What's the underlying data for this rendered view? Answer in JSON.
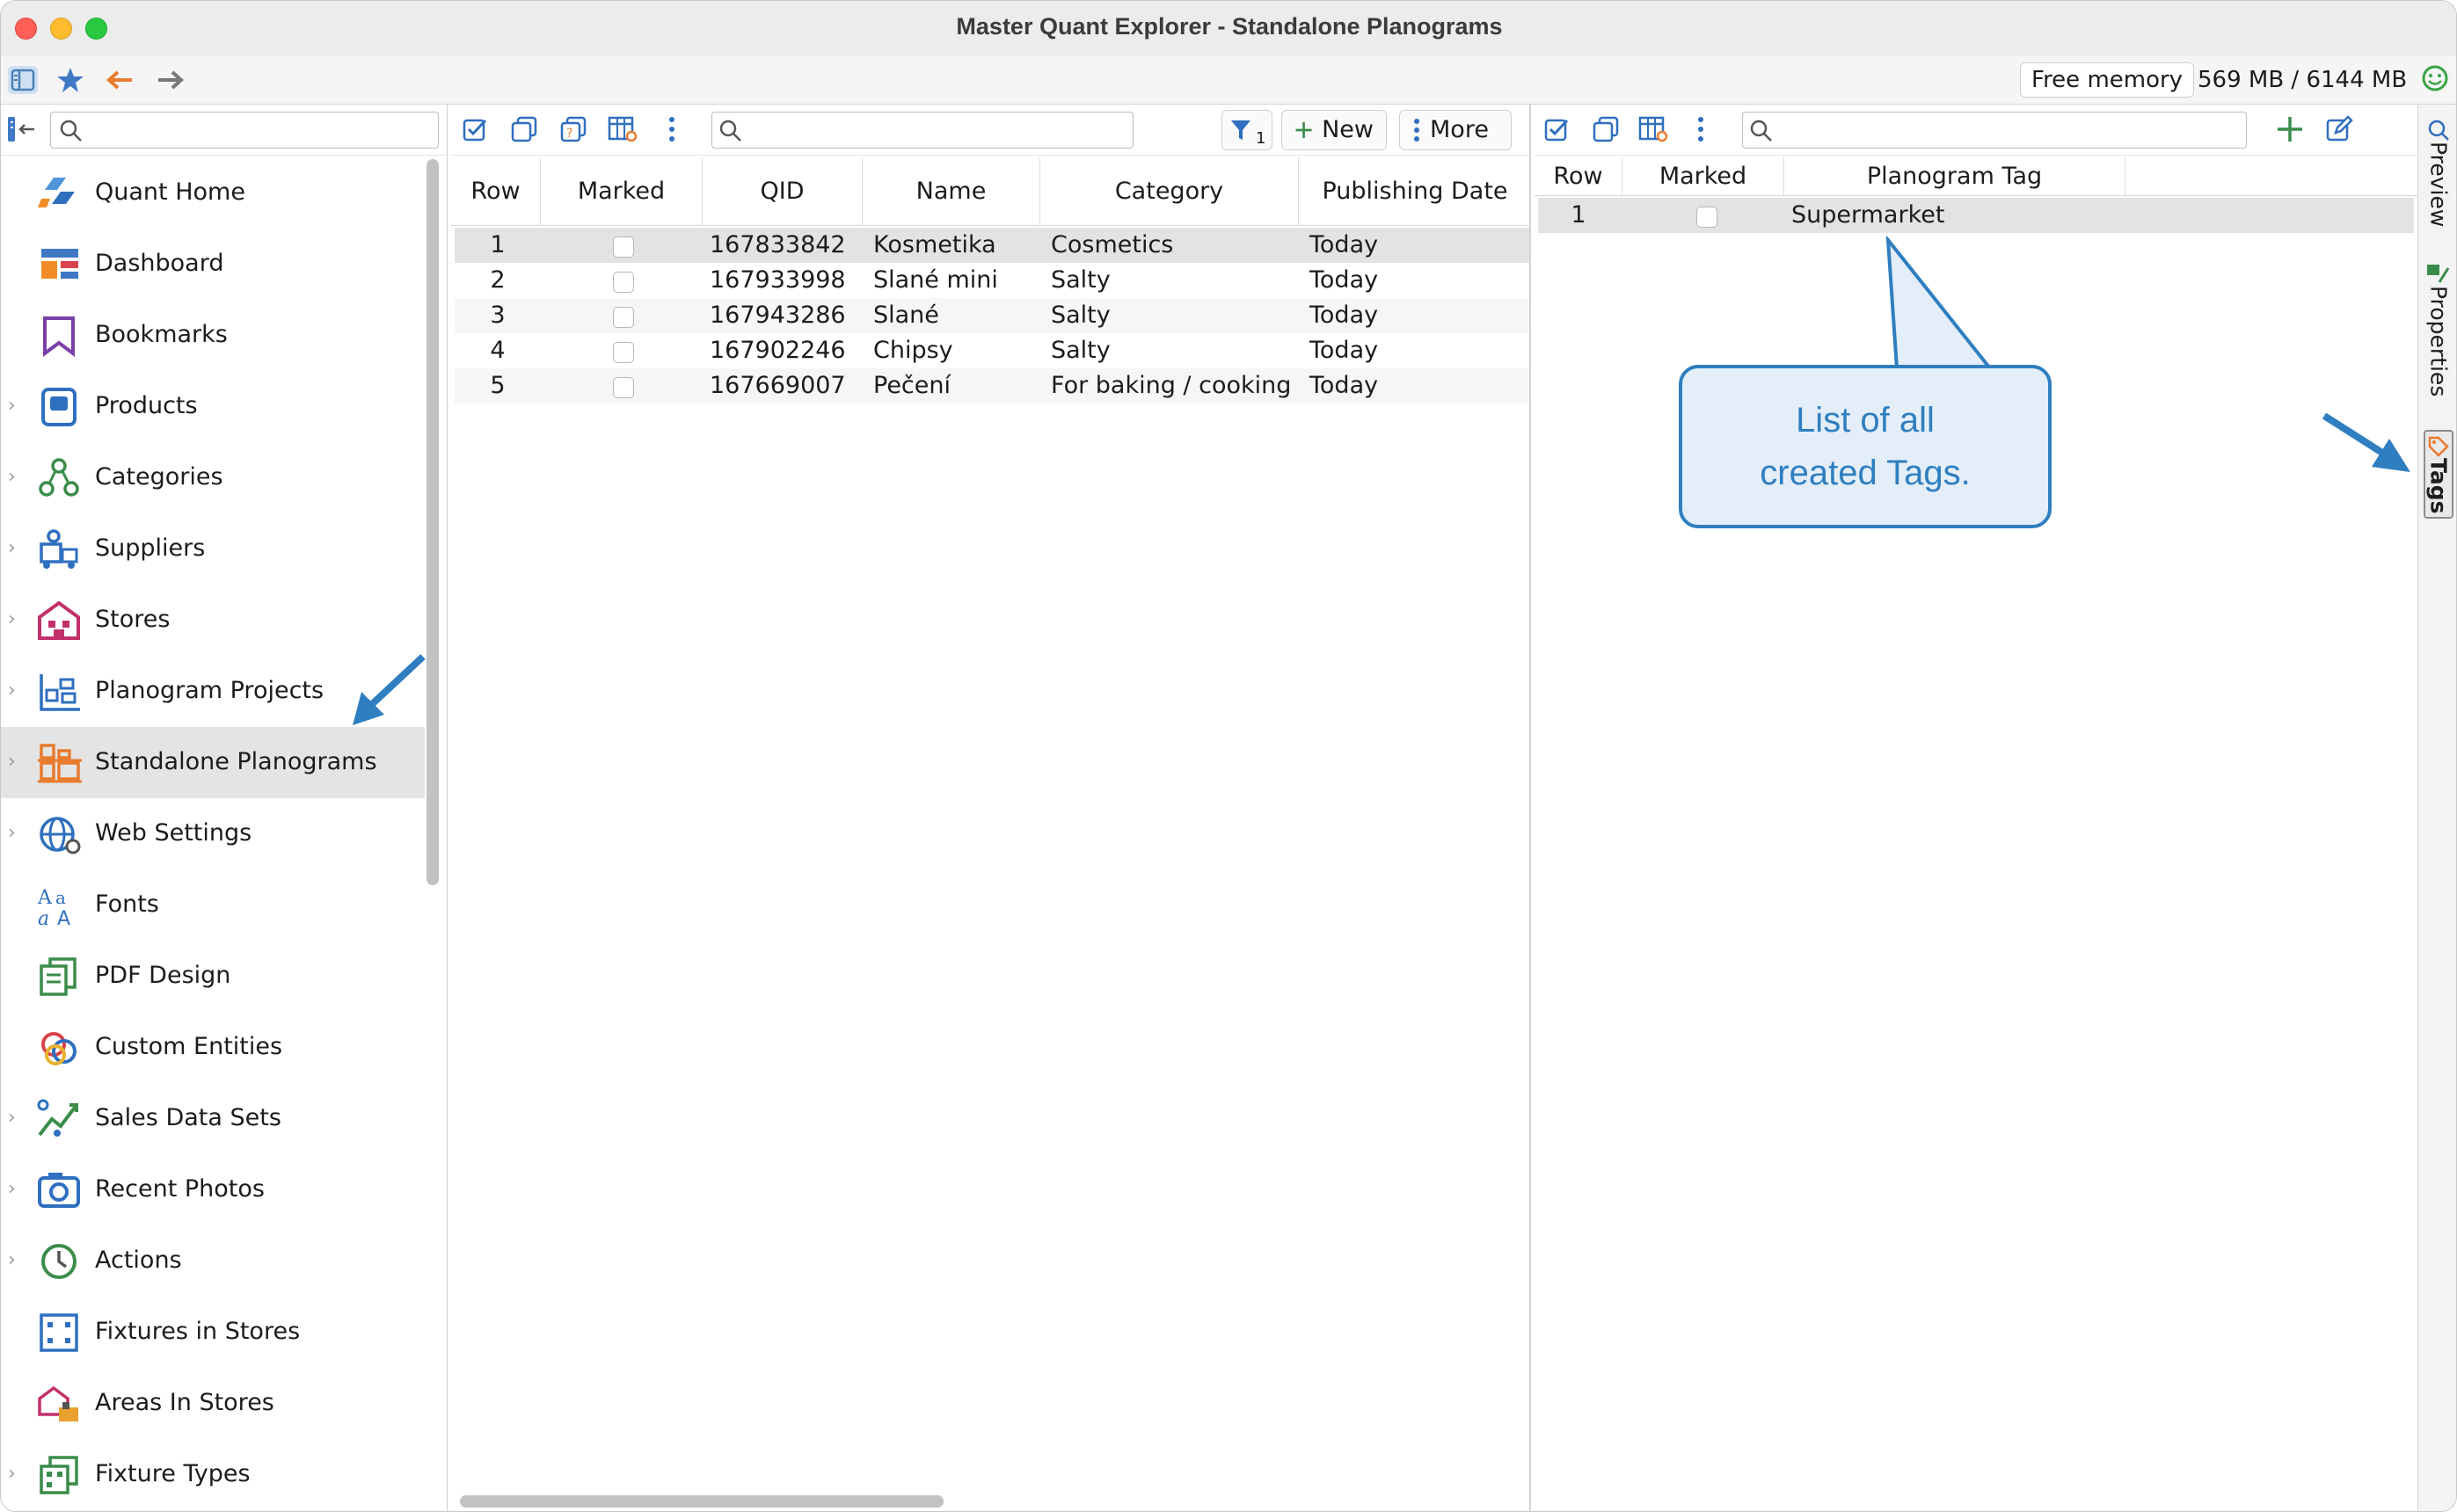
{
  "window": {
    "title": "Master Quant Explorer - Standalone Planograms"
  },
  "toolbar": {
    "free_memory_label": "Free memory",
    "memory_value": "569 MB / 6144 MB"
  },
  "nav": {
    "items": [
      {
        "label": "Quant Home",
        "icon": "quant-home-icon",
        "expandable": false
      },
      {
        "label": "Dashboard",
        "icon": "dashboard-icon",
        "expandable": false
      },
      {
        "label": "Bookmarks",
        "icon": "bookmark-icon",
        "expandable": false
      },
      {
        "label": "Products",
        "icon": "products-icon",
        "expandable": true
      },
      {
        "label": "Categories",
        "icon": "categories-icon",
        "expandable": true
      },
      {
        "label": "Suppliers",
        "icon": "suppliers-icon",
        "expandable": true
      },
      {
        "label": "Stores",
        "icon": "store-icon",
        "expandable": true
      },
      {
        "label": "Planogram Projects",
        "icon": "planogram-projects-icon",
        "expandable": true
      },
      {
        "label": "Standalone Planograms",
        "icon": "standalone-planograms-icon",
        "expandable": true,
        "selected": true
      },
      {
        "label": "Web Settings",
        "icon": "globe-icon",
        "expandable": true
      },
      {
        "label": "Fonts",
        "icon": "fonts-icon",
        "expandable": false
      },
      {
        "label": "PDF Design",
        "icon": "pdf-design-icon",
        "expandable": false
      },
      {
        "label": "Custom Entities",
        "icon": "custom-entities-icon",
        "expandable": false
      },
      {
        "label": "Sales Data Sets",
        "icon": "sales-data-icon",
        "expandable": true
      },
      {
        "label": "Recent Photos",
        "icon": "camera-icon",
        "expandable": true
      },
      {
        "label": "Actions",
        "icon": "actions-icon",
        "expandable": true
      },
      {
        "label": "Fixtures in Stores",
        "icon": "fixtures-icon",
        "expandable": false
      },
      {
        "label": "Areas In Stores",
        "icon": "areas-icon",
        "expandable": false
      },
      {
        "label": "Fixture Types",
        "icon": "fixture-types-icon",
        "expandable": true
      }
    ]
  },
  "planograms": {
    "filter_count": "1",
    "new_label": "New",
    "more_label": "More",
    "columns": [
      "Row",
      "Marked",
      "QID",
      "Name",
      "Category",
      "Publishing Date"
    ],
    "rows": [
      {
        "row": "1",
        "qid": "167833842",
        "name": "Kosmetika",
        "category": "Cosmetics",
        "date": "Today"
      },
      {
        "row": "2",
        "qid": "167933998",
        "name": "Slané mini",
        "category": "Salty",
        "date": "Today"
      },
      {
        "row": "3",
        "qid": "167943286",
        "name": "Slané",
        "category": "Salty",
        "date": "Today"
      },
      {
        "row": "4",
        "qid": "167902246",
        "name": "Chipsy",
        "category": "Salty",
        "date": "Today"
      },
      {
        "row": "5",
        "qid": "167669007",
        "name": "Pečení",
        "category": "For baking / cooking",
        "date": "Today"
      }
    ]
  },
  "tags": {
    "columns": [
      "Row",
      "Marked",
      "Planogram Tag"
    ],
    "rows": [
      {
        "row": "1",
        "tag": "Supermarket"
      }
    ]
  },
  "side_tabs": {
    "preview": "Preview",
    "properties": "Properties",
    "tags": "Tags"
  },
  "callout": {
    "line1": "List of all",
    "line2": "created Tags."
  },
  "colors": {
    "accent_blue": "#2f7ec0",
    "selection_gray": "#e3e3e3"
  }
}
